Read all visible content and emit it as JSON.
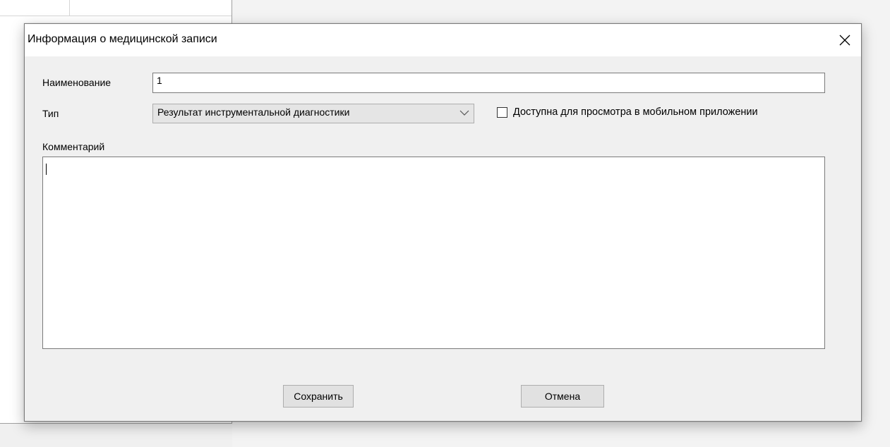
{
  "dialog": {
    "title": "Информация о медицинской записи",
    "close_icon": "close-icon"
  },
  "form": {
    "name_label": "Наименование",
    "name_value": "1",
    "type_label": "Тип",
    "type_value": "Результат инструментальной диагностики",
    "mobile_checkbox_label": "Доступна для просмотра в мобильном приложении",
    "mobile_checkbox_checked": false,
    "comment_label": "Комментарий",
    "comment_value": ""
  },
  "buttons": {
    "save_label": "Сохранить",
    "cancel_label": "Отмена"
  }
}
